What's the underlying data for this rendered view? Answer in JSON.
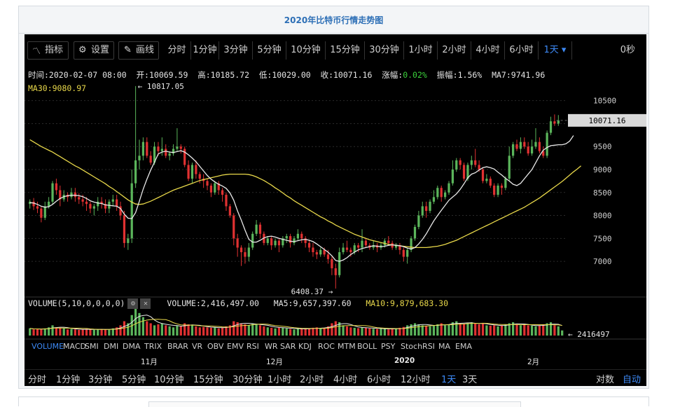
{
  "page": {
    "title": "2020年比特币行情走势图"
  },
  "toolbar": {
    "indicator_label": "指标",
    "settings_label": "设置",
    "draw_label": "画线",
    "periods": [
      "分时",
      "1分钟",
      "3分钟",
      "5分钟",
      "10分钟",
      "15分钟",
      "30分钟",
      "1小时",
      "2小时",
      "4小时",
      "6小时",
      "1天"
    ],
    "active_period": "1天",
    "countdown": "0秒"
  },
  "info": {
    "time": "时间:2020-02-07 08:00",
    "open": "开:10069.59",
    "high": "高:10185.72",
    "low": "低:10029.00",
    "close": "收:10071.16",
    "change_label": "涨幅:",
    "change_value": "0.02%",
    "amplitude": "振幅:1.56%",
    "ma7": "MA7:9741.96",
    "ma30": "MA30:9080.97"
  },
  "chart_data": {
    "type": "candlestick",
    "y_ticks": [
      7000,
      7500,
      8000,
      8500,
      9000,
      9500,
      10000,
      10500
    ],
    "y_tick_labels": [
      "7000",
      "7500",
      "8000",
      "8500",
      "9000",
      "9500",
      "",
      "10500"
    ],
    "ylim": [
      6300,
      10800
    ],
    "current_price": "10071.16",
    "max_annotation": "← 10817.05",
    "min_annotation": "6408.37 →",
    "x_labels": [
      "11月",
      "12月",
      "2020",
      "2月"
    ],
    "candles": [
      [
        8250,
        8300,
        8150,
        8350
      ],
      [
        8300,
        8200,
        8120,
        8380
      ],
      [
        8200,
        8150,
        8050,
        8300
      ],
      [
        8150,
        7950,
        7850,
        8200
      ],
      [
        7950,
        8200,
        7900,
        8300
      ],
      [
        8200,
        8300,
        8150,
        8400
      ],
      [
        8300,
        8700,
        8250,
        8750
      ],
      [
        8700,
        8550,
        8450,
        8800
      ],
      [
        8550,
        8350,
        8200,
        8650
      ],
      [
        8350,
        8450,
        8300,
        8550
      ],
      [
        8450,
        8400,
        8300,
        8500
      ],
      [
        8400,
        8500,
        8350,
        8600
      ],
      [
        8500,
        8400,
        8300,
        8600
      ],
      [
        8400,
        8350,
        8250,
        8480
      ],
      [
        8350,
        8300,
        8200,
        8450
      ],
      [
        8300,
        8250,
        8100,
        8400
      ],
      [
        8250,
        8150,
        8050,
        8300
      ],
      [
        8150,
        8200,
        8000,
        8250
      ],
      [
        8200,
        8300,
        8100,
        8400
      ],
      [
        8300,
        8250,
        8150,
        8400
      ],
      [
        8250,
        8150,
        8050,
        8350
      ],
      [
        8150,
        8300,
        8050,
        8350
      ],
      [
        8300,
        8350,
        8200,
        8450
      ],
      [
        8350,
        8200,
        8100,
        8450
      ],
      [
        8200,
        8000,
        7900,
        8300
      ],
      [
        8000,
        7400,
        7300,
        8100
      ],
      [
        7400,
        7500,
        7250,
        7600
      ],
      [
        7500,
        8700,
        7400,
        9000
      ],
      [
        8700,
        9200,
        8600,
        10817
      ],
      [
        9200,
        9300,
        9000,
        9650
      ],
      [
        9300,
        9600,
        9200,
        9700
      ],
      [
        9600,
        9300,
        9250,
        9700
      ],
      [
        9300,
        9150,
        9100,
        9400
      ],
      [
        9150,
        9500,
        9100,
        9600
      ],
      [
        9500,
        9400,
        9300,
        9600
      ],
      [
        9400,
        9450,
        9300,
        9700
      ],
      [
        9450,
        9300,
        9250,
        9550
      ],
      [
        9300,
        9350,
        9200,
        9400
      ],
      [
        9350,
        9450,
        9300,
        9550
      ],
      [
        9450,
        9500,
        9400,
        9900
      ],
      [
        9500,
        9450,
        9350,
        9550
      ],
      [
        9450,
        9100,
        9050,
        9500
      ],
      [
        9100,
        8800,
        8750,
        9200
      ],
      [
        8800,
        9100,
        8700,
        9150
      ],
      [
        9100,
        8900,
        8800,
        9200
      ],
      [
        8900,
        8800,
        8700,
        8950
      ],
      [
        8800,
        8750,
        8600,
        8900
      ],
      [
        8750,
        8650,
        8550,
        8800
      ],
      [
        8650,
        8500,
        8400,
        8700
      ],
      [
        8500,
        8700,
        8450,
        8750
      ],
      [
        8700,
        8550,
        8450,
        8750
      ],
      [
        8550,
        8450,
        8300,
        8600
      ],
      [
        8450,
        8200,
        8100,
        8500
      ],
      [
        8200,
        8000,
        7950,
        8250
      ],
      [
        8000,
        7500,
        7350,
        8050
      ],
      [
        7500,
        7300,
        7100,
        7600
      ],
      [
        7300,
        7200,
        6900,
        7350
      ],
      [
        7200,
        7100,
        6950,
        7300
      ],
      [
        7100,
        7300,
        7000,
        7400
      ],
      [
        7300,
        7600,
        7250,
        7650
      ],
      [
        7600,
        7800,
        7550,
        7900
      ],
      [
        7800,
        7600,
        7500,
        7850
      ],
      [
        7600,
        7400,
        7350,
        7650
      ],
      [
        7400,
        7500,
        7350,
        7550
      ],
      [
        7500,
        7350,
        7250,
        7550
      ],
      [
        7350,
        7450,
        7300,
        7500
      ],
      [
        7450,
        7350,
        7200,
        7500
      ],
      [
        7350,
        7500,
        7300,
        7550
      ],
      [
        7500,
        7550,
        7400,
        7600
      ],
      [
        7550,
        7400,
        7300,
        7600
      ],
      [
        7400,
        7500,
        7350,
        7550
      ],
      [
        7500,
        7600,
        7450,
        7700
      ],
      [
        7600,
        7500,
        7400,
        7650
      ],
      [
        7500,
        7400,
        7300,
        7550
      ],
      [
        7400,
        7300,
        7200,
        7450
      ],
      [
        7300,
        7200,
        7100,
        7400
      ],
      [
        7200,
        7150,
        7050,
        7250
      ],
      [
        7150,
        7250,
        7100,
        7300
      ],
      [
        7250,
        7150,
        7100,
        7300
      ],
      [
        7150,
        7050,
        6950,
        7250
      ],
      [
        7050,
        6850,
        6700,
        7100
      ],
      [
        6850,
        6700,
        6408,
        6950
      ],
      [
        6700,
        7200,
        6650,
        7300
      ],
      [
        7200,
        7300,
        7150,
        7400
      ],
      [
        7300,
        7250,
        7200,
        7450
      ],
      [
        7250,
        7200,
        7100,
        7300
      ],
      [
        7200,
        7350,
        7150,
        7400
      ],
      [
        7350,
        7300,
        7200,
        7400
      ],
      [
        7300,
        7450,
        7200,
        7700
      ],
      [
        7450,
        7350,
        7300,
        7500
      ],
      [
        7350,
        7300,
        7250,
        7400
      ],
      [
        7300,
        7350,
        7250,
        7450
      ],
      [
        7350,
        7300,
        7200,
        7400
      ],
      [
        7300,
        7350,
        7250,
        7400
      ],
      [
        7350,
        7450,
        7300,
        7500
      ],
      [
        7450,
        7400,
        7350,
        7550
      ],
      [
        7400,
        7300,
        7250,
        7450
      ],
      [
        7300,
        7350,
        7250,
        7400
      ],
      [
        7350,
        7250,
        7150,
        7400
      ],
      [
        7250,
        7100,
        7000,
        7300
      ],
      [
        7100,
        7250,
        6950,
        7300
      ],
      [
        7250,
        7500,
        7200,
        7550
      ],
      [
        7500,
        7750,
        7450,
        7800
      ],
      [
        7750,
        8000,
        7700,
        8100
      ],
      [
        8000,
        8200,
        7950,
        8300
      ],
      [
        8200,
        8100,
        7950,
        8300
      ],
      [
        8100,
        8300,
        8050,
        8350
      ],
      [
        8300,
        8400,
        8250,
        8550
      ],
      [
        8400,
        8600,
        8350,
        8650
      ],
      [
        8600,
        8400,
        8300,
        8650
      ],
      [
        8400,
        8500,
        8350,
        8550
      ],
      [
        8500,
        8700,
        8450,
        8750
      ],
      [
        8700,
        9000,
        8650,
        9200
      ],
      [
        9000,
        9200,
        8950,
        9250
      ],
      [
        9200,
        9100,
        9000,
        9250
      ],
      [
        9100,
        8800,
        8750,
        9150
      ],
      [
        8800,
        9100,
        8750,
        9150
      ],
      [
        9100,
        9200,
        9000,
        9300
      ],
      [
        9200,
        9100,
        9050,
        9450
      ],
      [
        9100,
        9000,
        8950,
        9200
      ],
      [
        9000,
        8750,
        8700,
        9050
      ],
      [
        8750,
        8800,
        8700,
        8900
      ],
      [
        8800,
        8650,
        8600,
        8850
      ],
      [
        8650,
        8450,
        8400,
        8700
      ],
      [
        8450,
        8650,
        8400,
        8700
      ],
      [
        8650,
        8600,
        8450,
        8700
      ],
      [
        8600,
        8800,
        8550,
        8850
      ],
      [
        8800,
        9300,
        8750,
        9500
      ],
      [
        9300,
        9550,
        9250,
        9600
      ],
      [
        9550,
        9450,
        9400,
        9650
      ],
      [
        9450,
        9600,
        9350,
        9700
      ],
      [
        9600,
        9500,
        9450,
        9700
      ],
      [
        9500,
        9350,
        9300,
        9600
      ],
      [
        9350,
        9500,
        9300,
        9650
      ],
      [
        9500,
        9600,
        9450,
        9900
      ],
      [
        9600,
        9400,
        9350,
        9700
      ],
      [
        9400,
        9300,
        9250,
        9500
      ],
      [
        9300,
        9800,
        9250,
        9850
      ],
      [
        9800,
        10050,
        9750,
        10150
      ],
      [
        10050,
        10000,
        9950,
        10200
      ],
      [
        10000,
        10070,
        9950,
        10186
      ]
    ],
    "ma7": [
      8280,
      8270,
      8240,
      8200,
      8180,
      8190,
      8240,
      8310,
      8370,
      8410,
      8430,
      8440,
      8440,
      8430,
      8410,
      8370,
      8320,
      8290,
      8270,
      8260,
      8230,
      8220,
      8210,
      8200,
      8150,
      8030,
      7940,
      7930,
      8060,
      8310,
      8570,
      8790,
      8990,
      9160,
      9340,
      9380,
      9400,
      9380,
      9370,
      9390,
      9410,
      9380,
      9320,
      9250,
      9170,
      9070,
      8970,
      8870,
      8790,
      8730,
      8680,
      8640,
      8590,
      8490,
      8330,
      8100,
      7900,
      7680,
      7480,
      7420,
      7420,
      7460,
      7510,
      7540,
      7550,
      7530,
      7500,
      7480,
      7460,
      7440,
      7430,
      7450,
      7470,
      7480,
      7460,
      7430,
      7380,
      7320,
      7260,
      7200,
      7120,
      7020,
      7000,
      7030,
      7080,
      7150,
      7200,
      7250,
      7280,
      7300,
      7320,
      7340,
      7330,
      7320,
      7330,
      7350,
      7360,
      7350,
      7340,
      7320,
      7290,
      7270,
      7300,
      7380,
      7480,
      7600,
      7740,
      7880,
      8000,
      8110,
      8220,
      8330,
      8400,
      8470,
      8570,
      8690,
      8820,
      8900,
      8930,
      8990,
      9040,
      9060,
      9040,
      9010,
      8940,
      8880,
      8810,
      8750,
      8680,
      8650,
      8700,
      8800,
      8900,
      9000,
      9150,
      9300,
      9420,
      9480,
      9520,
      9530,
      9540,
      9540,
      9560,
      9620,
      9740
    ],
    "ma30": [
      9650,
      9600,
      9550,
      9500,
      9460,
      9420,
      9380,
      9330,
      9280,
      9230,
      9180,
      9130,
      9080,
      9040,
      8990,
      8940,
      8890,
      8840,
      8790,
      8740,
      8690,
      8630,
      8580,
      8520,
      8460,
      8400,
      8340,
      8290,
      8250,
      8240,
      8250,
      8280,
      8310,
      8350,
      8390,
      8430,
      8470,
      8510,
      8550,
      8580,
      8610,
      8640,
      8670,
      8700,
      8730,
      8760,
      8780,
      8800,
      8820,
      8840,
      8860,
      8880,
      8890,
      8900,
      8900,
      8900,
      8900,
      8900,
      8890,
      8870,
      8840,
      8800,
      8760,
      8710,
      8660,
      8600,
      8550,
      8490,
      8430,
      8380,
      8320,
      8270,
      8220,
      8170,
      8120,
      8070,
      8020,
      7970,
      7930,
      7880,
      7840,
      7790,
      7750,
      7710,
      7670,
      7630,
      7590,
      7560,
      7530,
      7500,
      7470,
      7450,
      7430,
      7410,
      7390,
      7370,
      7360,
      7350,
      7340,
      7330,
      7320,
      7310,
      7300,
      7300,
      7300,
      7300,
      7310,
      7320,
      7330,
      7350,
      7370,
      7400,
      7430,
      7460,
      7500,
      7540,
      7580,
      7620,
      7660,
      7700,
      7740,
      7780,
      7820,
      7860,
      7900,
      7940,
      7980,
      8020,
      8060,
      8100,
      8140,
      8180,
      8230,
      8280,
      8330,
      8380,
      8440,
      8500,
      8560,
      8620,
      8680,
      8740,
      8810,
      8880,
      8950,
      9010,
      9081
    ]
  },
  "volume": {
    "label": "VOLUME(5,10,0,0,0,0)",
    "value": "VOLUME:2,416,497.00",
    "ma5": "MA5:9,657,397.60",
    "ma10": "MA10:9,879,683.30",
    "current_annotation": "← 2416497",
    "bars": [
      0.35,
      0.3,
      0.32,
      0.3,
      0.35,
      0.4,
      0.5,
      0.4,
      0.38,
      0.35,
      0.3,
      0.32,
      0.3,
      0.28,
      0.3,
      0.32,
      0.3,
      0.28,
      0.3,
      0.32,
      0.3,
      0.28,
      0.35,
      0.4,
      0.5,
      0.7,
      0.6,
      1.0,
      1.3,
      1.1,
      0.9,
      0.7,
      0.6,
      0.5,
      0.55,
      0.6,
      0.5,
      0.45,
      0.4,
      0.5,
      0.45,
      0.6,
      0.55,
      0.5,
      0.45,
      0.4,
      0.42,
      0.4,
      0.38,
      0.4,
      0.35,
      0.38,
      0.45,
      0.5,
      0.7,
      0.65,
      0.6,
      0.55,
      0.5,
      0.6,
      0.55,
      0.5,
      0.45,
      0.4,
      0.38,
      0.35,
      0.4,
      0.38,
      0.35,
      0.32,
      0.3,
      0.35,
      0.33,
      0.32,
      0.35,
      0.38,
      0.4,
      0.35,
      0.38,
      0.45,
      0.6,
      0.7,
      0.65,
      0.5,
      0.45,
      0.4,
      0.38,
      0.36,
      0.4,
      0.38,
      0.35,
      0.33,
      0.32,
      0.35,
      0.33,
      0.3,
      0.32,
      0.35,
      0.38,
      0.42,
      0.5,
      0.55,
      0.6,
      0.55,
      0.5,
      0.48,
      0.45,
      0.5,
      0.55,
      0.6,
      0.5,
      0.55,
      0.65,
      0.7,
      0.6,
      0.55,
      0.6,
      0.65,
      0.6,
      0.55,
      0.58,
      0.5,
      0.48,
      0.5,
      0.45,
      0.5,
      0.55,
      0.6,
      0.65,
      0.55,
      0.5,
      0.52,
      0.5,
      0.48,
      0.45,
      0.5,
      0.55,
      0.6,
      0.65,
      0.5,
      0.45,
      0.25
    ]
  },
  "indicators": [
    "VOLUME",
    "MACD",
    "SMI",
    "DMI",
    "DMA",
    "TRIX",
    "BRAR",
    "VR",
    "OBV",
    "EMV",
    "RSI",
    "WR",
    "SAR",
    "KDJ",
    "ROC",
    "MTM",
    "BOLL",
    "PSY",
    "StochRSI",
    "MA",
    "EMA"
  ],
  "active_indicator": "VOLUME",
  "bottom_periods": [
    "分时",
    "1分钟",
    "3分钟",
    "5分钟",
    "10分钟",
    "15分钟",
    "30分钟",
    "1小时",
    "2小时",
    "4小时",
    "6小时",
    "12小时",
    "1天",
    "3天"
  ],
  "active_bottom_period": "1天",
  "scale_options": [
    "对数",
    "自动"
  ],
  "active_scale": "自动",
  "colors": {
    "up": "#5bb55b",
    "down": "#e03131",
    "ma7": "#e8e8e8",
    "ma30": "#e8d84a",
    "active": "#3d8af7",
    "title": "#2d6fb6"
  }
}
